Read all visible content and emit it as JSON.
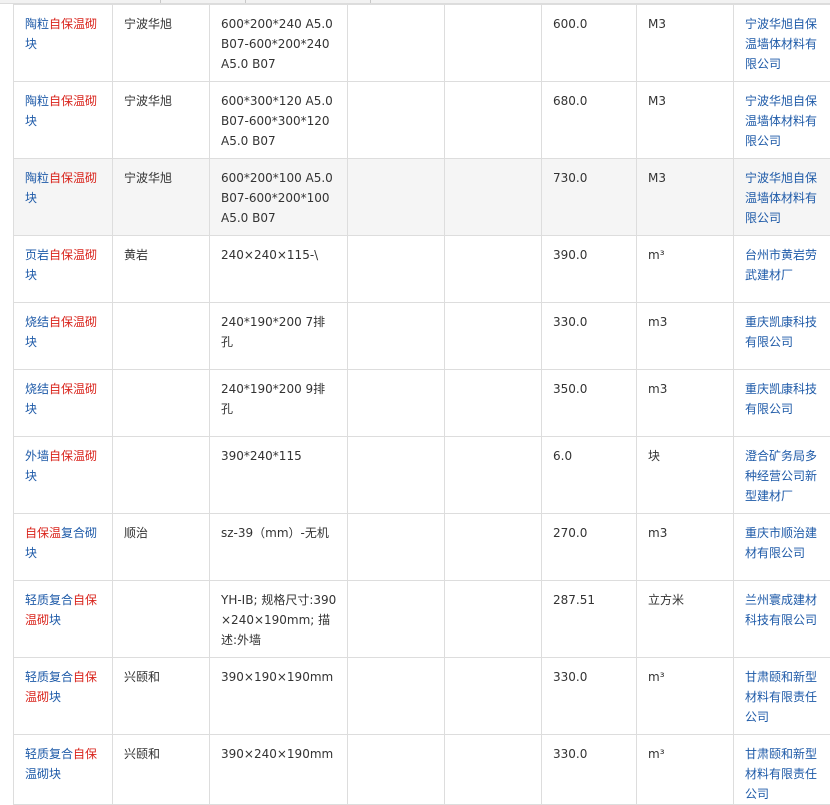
{
  "columns": [
    "name",
    "brand",
    "spec",
    "blank1",
    "blank2",
    "price",
    "unit",
    "supplier"
  ],
  "rows": [
    {
      "name_pre": "陶粒",
      "name_kw": "自保温砌",
      "name_post": "块",
      "brand": "宁波华旭",
      "spec": "600*200*240 A5.0 B07-600*200*240 A5.0 B07",
      "price": "600.0",
      "unit": "M3",
      "supplier": "宁波华旭自保温墙体材料有限公司"
    },
    {
      "name_pre": "陶粒",
      "name_kw": "自保温砌",
      "name_post": "块",
      "brand": "宁波华旭",
      "spec": "600*300*120 A5.0 B07-600*300*120 A5.0 B07",
      "price": "680.0",
      "unit": "M3",
      "supplier": "宁波华旭自保温墙体材料有限公司"
    },
    {
      "name_pre": "陶粒",
      "name_kw": "自保温砌",
      "name_post": "块",
      "brand": "宁波华旭",
      "spec": "600*200*100 A5.0 B07-600*200*100 A5.0 B07",
      "price": "730.0",
      "unit": "M3",
      "supplier": "宁波华旭自保温墙体材料有限公司",
      "highlighted": true
    },
    {
      "name_pre": "页岩",
      "name_kw": "自保温砌",
      "name_post": "块",
      "brand": "黄岩",
      "spec": "240×240×115-\\",
      "price": "390.0",
      "unit": "m³",
      "supplier": "台州市黄岩劳武建材厂"
    },
    {
      "name_pre": "烧结",
      "name_kw": "自保温砌",
      "name_post": "块",
      "brand": "",
      "spec": "240*190*200 7排孔",
      "price": "330.0",
      "unit": "m3",
      "supplier": "重庆凯康科技有限公司"
    },
    {
      "name_pre": "烧结",
      "name_kw": "自保温砌",
      "name_post": "块",
      "brand": "",
      "spec": "240*190*200 9排孔",
      "price": "350.0",
      "unit": "m3",
      "supplier": "重庆凯康科技有限公司"
    },
    {
      "name_pre": "外墙",
      "name_kw": "自保温砌",
      "name_post": "块",
      "brand": "",
      "spec": "390*240*115",
      "price": "6.0",
      "unit": "块",
      "supplier": "澄合矿务局多种经营公司新型建材厂"
    },
    {
      "name_pre": "",
      "name_kw": "自保温",
      "name_post": "复合砌块",
      "brand": "顺治",
      "spec": "sz-39（mm）-无机",
      "price": "270.0",
      "unit": "m3",
      "supplier": "重庆市顺治建材有限公司"
    },
    {
      "name_pre": "轻质复合",
      "name_kw": "自保温砌",
      "name_post": "块",
      "brand": "",
      "spec": "YH-IB; 规格尺寸:390×240×190mm; 描述:外墙",
      "price": "287.51",
      "unit": "立方米",
      "supplier": "兰州寰成建材科技有限公司"
    },
    {
      "name_pre": "轻质复合",
      "name_kw": "自保温砌",
      "name_post": "块",
      "brand": "兴颐和",
      "spec": "390×190×190mm",
      "price": "330.0",
      "unit": "m³",
      "supplier": "甘肃颐和新型材料有限责任公司"
    },
    {
      "name_pre": "轻质复合",
      "name_kw": "自保",
      "name_post": "温砌块",
      "brand": "兴颐和",
      "spec": "390×240×190mm",
      "price": "330.0",
      "unit": "m³",
      "supplier": "甘肃颐和新型材料有限责任公司"
    }
  ]
}
